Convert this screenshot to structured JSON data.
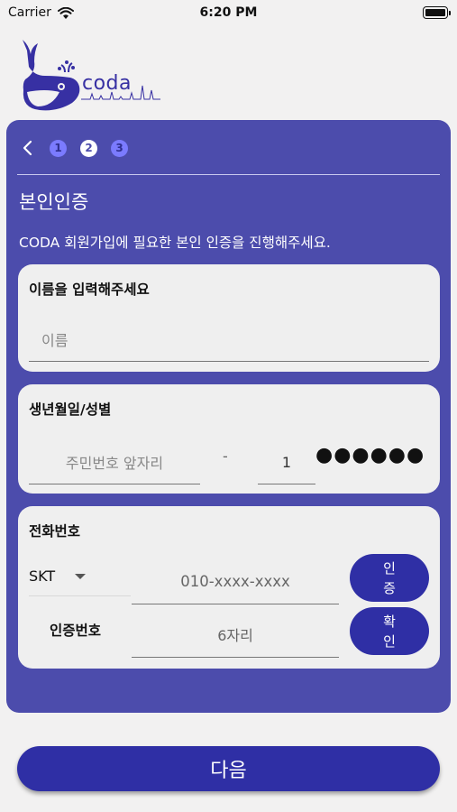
{
  "status_bar": {
    "carrier": "Carrier",
    "time": "6:20 PM"
  },
  "logo": {
    "text": "coda"
  },
  "steps": {
    "items": [
      "1",
      "2",
      "3"
    ],
    "active": "2"
  },
  "page": {
    "title": "본인인증",
    "subtitle": "CODA 회원가입에 필요한 본인 인증을 진행해주세요."
  },
  "name_card": {
    "label": "이름을 입력해주세요",
    "placeholder": "이름"
  },
  "birth_card": {
    "label": "생년월일/성별",
    "front_placeholder": "주민번호 앞자리",
    "separator": "-",
    "gender_digit": "1",
    "masked": "●●●●●●"
  },
  "phone_card": {
    "label": "전화번호",
    "carrier": "SKT",
    "phone_placeholder": "010-xxxx-xxxx",
    "auth_button": "인증",
    "code_label": "인증번호",
    "code_placeholder": "6자리",
    "confirm_button": "확인"
  },
  "footer": {
    "next_button": "다음"
  },
  "colors": {
    "primary": "#4c4cac",
    "button": "#2f2fa5",
    "step_inactive": "#7b7bff",
    "background": "#f2f1f1"
  }
}
